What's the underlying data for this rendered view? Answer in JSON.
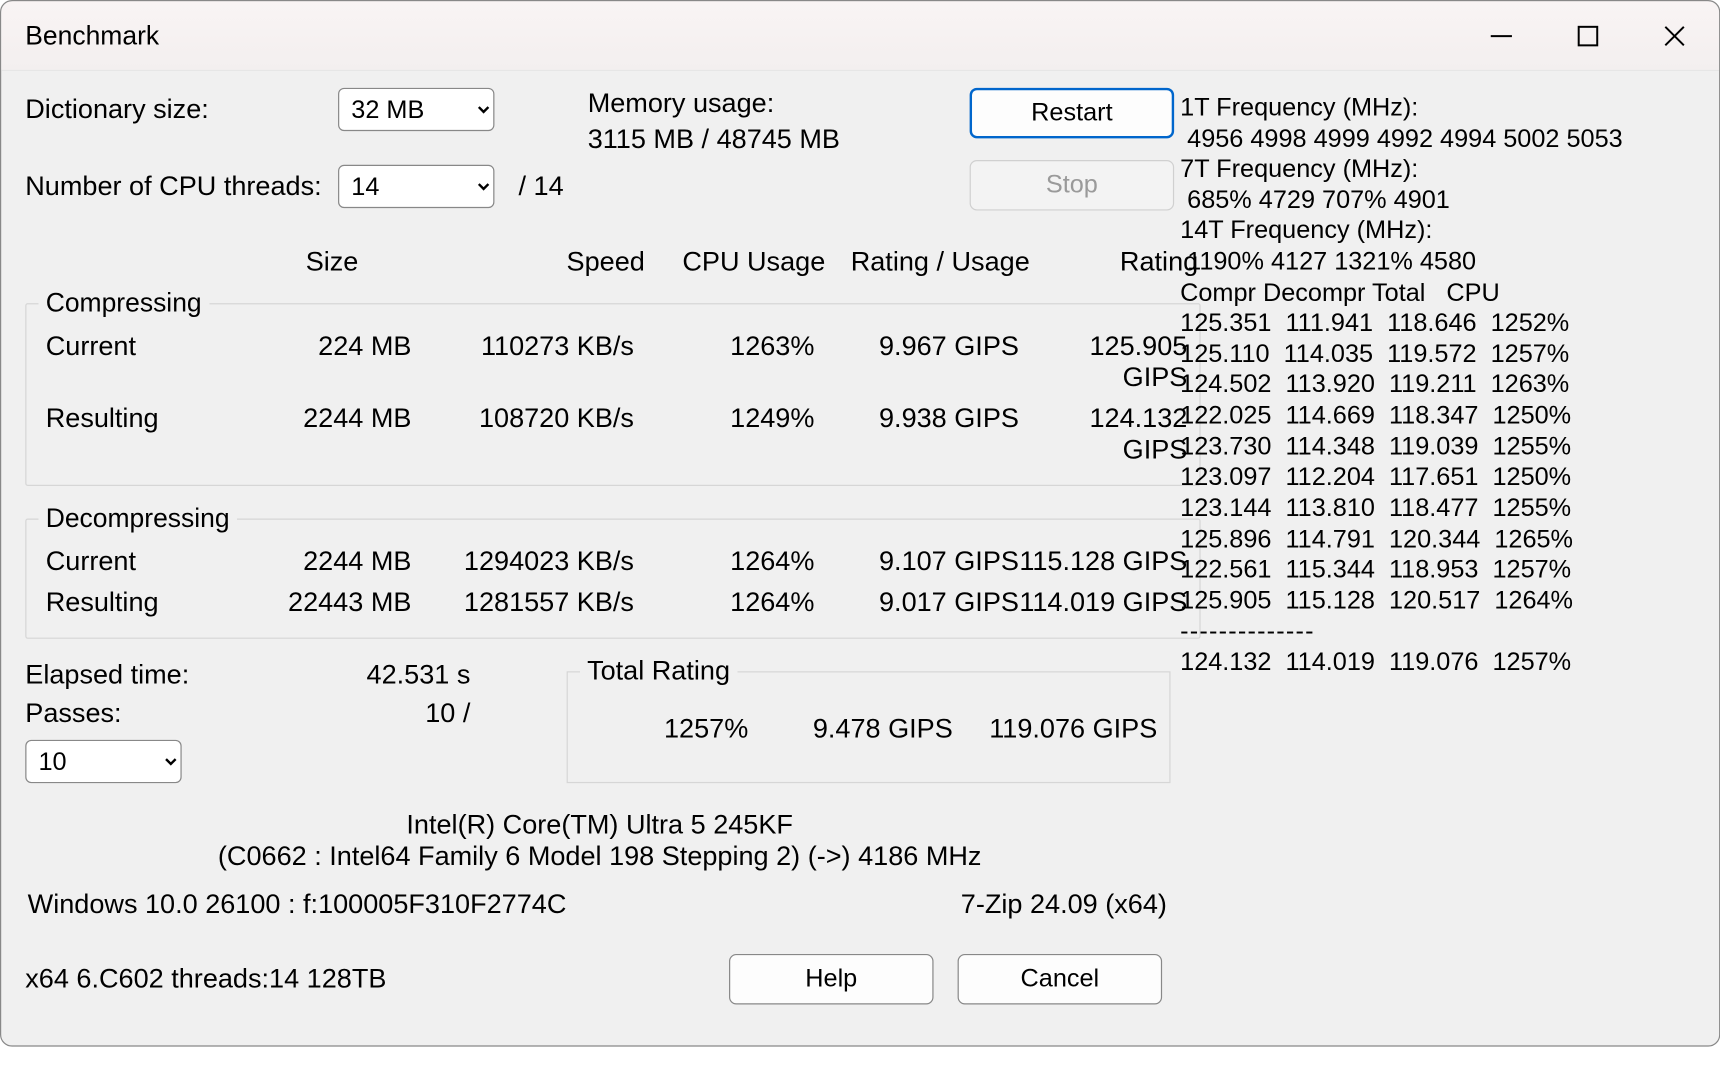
{
  "window": {
    "title": "Benchmark"
  },
  "controls": {
    "dict_label": "Dictionary size:",
    "dict_value": "32 MB",
    "threads_label": "Number of CPU threads:",
    "threads_value": "14",
    "threads_max": "/ 14",
    "mem_label": "Memory usage:",
    "mem_value": "3115 MB / 48745 MB",
    "restart": "Restart",
    "stop": "Stop"
  },
  "headers": {
    "size": "Size",
    "speed": "Speed",
    "cpu": "CPU Usage",
    "ru": "Rating / Usage",
    "rating": "Rating"
  },
  "compressing": {
    "legend": "Compressing",
    "current_label": "Current",
    "resulting_label": "Resulting",
    "current": {
      "size": "224 MB",
      "speed": "110273 KB/s",
      "cpu": "1263%",
      "ru": "9.967 GIPS",
      "rating": "125.905 GIPS"
    },
    "resulting": {
      "size": "2244 MB",
      "speed": "108720 KB/s",
      "cpu": "1249%",
      "ru": "9.938 GIPS",
      "rating": "124.132 GIPS"
    }
  },
  "decompressing": {
    "legend": "Decompressing",
    "current_label": "Current",
    "resulting_label": "Resulting",
    "current": {
      "size": "2244 MB",
      "speed": "1294023 KB/s",
      "cpu": "1264%",
      "ru": "9.107 GIPS",
      "rating": "115.128 GIPS"
    },
    "resulting": {
      "size": "22443 MB",
      "speed": "1281557 KB/s",
      "cpu": "1264%",
      "ru": "9.017 GIPS",
      "rating": "114.019 GIPS"
    }
  },
  "elapsed": {
    "label": "Elapsed time:",
    "value": "42.531 s"
  },
  "passes": {
    "label": "Passes:",
    "value": "10 /",
    "select": "10"
  },
  "total": {
    "legend": "Total Rating",
    "cpu": "1257%",
    "ru": "9.478 GIPS",
    "rating": "119.076 GIPS"
  },
  "cpu_info": {
    "line1": "Intel(R) Core(TM) Ultra 5 245KF",
    "line2": "(C0662 : Intel64 Family 6 Model 198 Stepping 2) (->) 4186 MHz"
  },
  "os": "Windows 10.0 26100 : f:100005F310F2774C",
  "zip": "7-Zip 24.09 (x64)",
  "arch": "x64 6.C602 threads:14 128TB",
  "buttons": {
    "help": "Help",
    "cancel": "Cancel"
  },
  "freq": {
    "t1_label": "1T Frequency (MHz):",
    "t1_vals": " 4956 4998 4999 4992 4994 5002 5053",
    "t7_label": "7T Frequency (MHz):",
    "t7_vals": " 685% 4729 707% 4901",
    "t14_label": "14T Frequency (MHz):",
    "t14_vals": " 1190% 4127 1321% 4580"
  },
  "log": {
    "header": "Compr Decompr Total   CPU",
    "rows": [
      "125.351  111.941  118.646  1252%",
      "125.110  114.035  119.572  1257%",
      "124.502  113.920  119.211  1263%",
      "122.025  114.669  118.347  1250%",
      "123.730  114.348  119.039  1255%",
      "123.097  112.204  117.651  1250%",
      "123.144  113.810  118.477  1255%",
      "125.896  114.791  120.344  1265%",
      "122.561  115.344  118.953  1257%",
      "125.905  115.128  120.517  1264%"
    ],
    "divider": "--------------",
    "summary": "124.132  114.019  119.076  1257%"
  }
}
